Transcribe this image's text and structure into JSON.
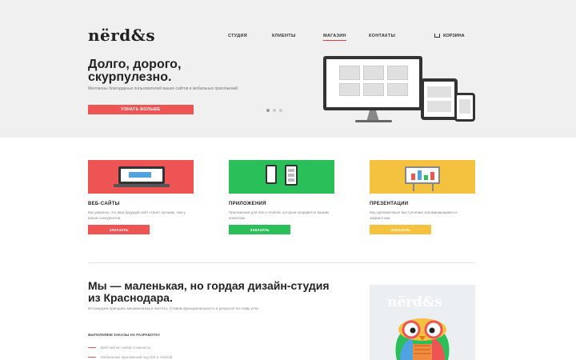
{
  "header": {
    "logo": "nërd&s",
    "nav": [
      {
        "label": "Студия",
        "active": false
      },
      {
        "label": "Клиенты",
        "active": false
      },
      {
        "label": "Магазин",
        "active": true
      },
      {
        "label": "Контакты",
        "active": false
      }
    ],
    "cart_label": "Корзина"
  },
  "hero": {
    "title": "Долго, дорого, скурпулезно.",
    "subtitle": "Миллионы благодарных пользователей ваших сайтов и мобильных приложений.",
    "button_label": "Узнать больше"
  },
  "services": [
    {
      "title": "Веб-сайты",
      "text": "Мы уверены, что ваш будущий сайт станет лучшим, чем у ваших конкурентов.",
      "button_label": "Заказать",
      "color": "#ef5454"
    },
    {
      "title": "Приложения",
      "text": "Приложения для iOS и Android, которые понравятся вашим клиентам.",
      "button_label": "Заказать",
      "color": "#2bbf5a"
    },
    {
      "title": "Презентации",
      "text": "Мы сделаем ваше выступление запоминающимся и эффектным.",
      "button_label": "Заказать",
      "color": "#f4c23e"
    }
  ],
  "about": {
    "title": "Мы — маленькая, но гордая дизайн-студия из Краснодара.",
    "subtitle": "Исповедуем принципы минимализма и чистоты. Ставим функциональность и результат во главу угла.",
    "label": "Выполняем заказы на разработку",
    "items": [
      "Веб-сайтов любой сложности",
      "Мобильных приложений под iOS и Android"
    ],
    "promo_logo": "nërd&s"
  },
  "colors": {
    "accent": "#ef5454",
    "green": "#2bbf5a",
    "yellow": "#f4c23e",
    "hero_bg": "#f0f0f0"
  }
}
